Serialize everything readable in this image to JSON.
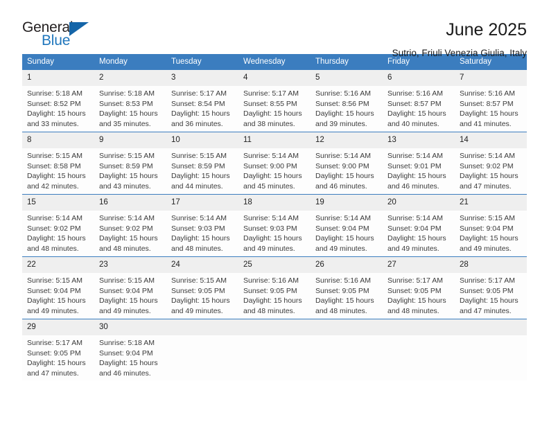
{
  "brand": {
    "name_part1": "General",
    "name_part2": "Blue",
    "logo_icon": "triangle-logo-icon"
  },
  "header": {
    "title": "June 2025",
    "subtitle": "Sutrio, Friuli Venezia Giulia, Italy"
  },
  "calendar": {
    "weekday_headers": [
      "Sunday",
      "Monday",
      "Tuesday",
      "Wednesday",
      "Thursday",
      "Friday",
      "Saturday"
    ],
    "accent_color": "#3b7dbf",
    "daynum_band_color": "#efefef",
    "weeks": [
      [
        {
          "day": "1",
          "sunrise": "Sunrise: 5:18 AM",
          "sunset": "Sunset: 8:52 PM",
          "daylight": "Daylight: 15 hours and 33 minutes."
        },
        {
          "day": "2",
          "sunrise": "Sunrise: 5:18 AM",
          "sunset": "Sunset: 8:53 PM",
          "daylight": "Daylight: 15 hours and 35 minutes."
        },
        {
          "day": "3",
          "sunrise": "Sunrise: 5:17 AM",
          "sunset": "Sunset: 8:54 PM",
          "daylight": "Daylight: 15 hours and 36 minutes."
        },
        {
          "day": "4",
          "sunrise": "Sunrise: 5:17 AM",
          "sunset": "Sunset: 8:55 PM",
          "daylight": "Daylight: 15 hours and 38 minutes."
        },
        {
          "day": "5",
          "sunrise": "Sunrise: 5:16 AM",
          "sunset": "Sunset: 8:56 PM",
          "daylight": "Daylight: 15 hours and 39 minutes."
        },
        {
          "day": "6",
          "sunrise": "Sunrise: 5:16 AM",
          "sunset": "Sunset: 8:57 PM",
          "daylight": "Daylight: 15 hours and 40 minutes."
        },
        {
          "day": "7",
          "sunrise": "Sunrise: 5:16 AM",
          "sunset": "Sunset: 8:57 PM",
          "daylight": "Daylight: 15 hours and 41 minutes."
        }
      ],
      [
        {
          "day": "8",
          "sunrise": "Sunrise: 5:15 AM",
          "sunset": "Sunset: 8:58 PM",
          "daylight": "Daylight: 15 hours and 42 minutes."
        },
        {
          "day": "9",
          "sunrise": "Sunrise: 5:15 AM",
          "sunset": "Sunset: 8:59 PM",
          "daylight": "Daylight: 15 hours and 43 minutes."
        },
        {
          "day": "10",
          "sunrise": "Sunrise: 5:15 AM",
          "sunset": "Sunset: 8:59 PM",
          "daylight": "Daylight: 15 hours and 44 minutes."
        },
        {
          "day": "11",
          "sunrise": "Sunrise: 5:14 AM",
          "sunset": "Sunset: 9:00 PM",
          "daylight": "Daylight: 15 hours and 45 minutes."
        },
        {
          "day": "12",
          "sunrise": "Sunrise: 5:14 AM",
          "sunset": "Sunset: 9:00 PM",
          "daylight": "Daylight: 15 hours and 46 minutes."
        },
        {
          "day": "13",
          "sunrise": "Sunrise: 5:14 AM",
          "sunset": "Sunset: 9:01 PM",
          "daylight": "Daylight: 15 hours and 46 minutes."
        },
        {
          "day": "14",
          "sunrise": "Sunrise: 5:14 AM",
          "sunset": "Sunset: 9:02 PM",
          "daylight": "Daylight: 15 hours and 47 minutes."
        }
      ],
      [
        {
          "day": "15",
          "sunrise": "Sunrise: 5:14 AM",
          "sunset": "Sunset: 9:02 PM",
          "daylight": "Daylight: 15 hours and 48 minutes."
        },
        {
          "day": "16",
          "sunrise": "Sunrise: 5:14 AM",
          "sunset": "Sunset: 9:02 PM",
          "daylight": "Daylight: 15 hours and 48 minutes."
        },
        {
          "day": "17",
          "sunrise": "Sunrise: 5:14 AM",
          "sunset": "Sunset: 9:03 PM",
          "daylight": "Daylight: 15 hours and 48 minutes."
        },
        {
          "day": "18",
          "sunrise": "Sunrise: 5:14 AM",
          "sunset": "Sunset: 9:03 PM",
          "daylight": "Daylight: 15 hours and 49 minutes."
        },
        {
          "day": "19",
          "sunrise": "Sunrise: 5:14 AM",
          "sunset": "Sunset: 9:04 PM",
          "daylight": "Daylight: 15 hours and 49 minutes."
        },
        {
          "day": "20",
          "sunrise": "Sunrise: 5:14 AM",
          "sunset": "Sunset: 9:04 PM",
          "daylight": "Daylight: 15 hours and 49 minutes."
        },
        {
          "day": "21",
          "sunrise": "Sunrise: 5:15 AM",
          "sunset": "Sunset: 9:04 PM",
          "daylight": "Daylight: 15 hours and 49 minutes."
        }
      ],
      [
        {
          "day": "22",
          "sunrise": "Sunrise: 5:15 AM",
          "sunset": "Sunset: 9:04 PM",
          "daylight": "Daylight: 15 hours and 49 minutes."
        },
        {
          "day": "23",
          "sunrise": "Sunrise: 5:15 AM",
          "sunset": "Sunset: 9:04 PM",
          "daylight": "Daylight: 15 hours and 49 minutes."
        },
        {
          "day": "24",
          "sunrise": "Sunrise: 5:15 AM",
          "sunset": "Sunset: 9:05 PM",
          "daylight": "Daylight: 15 hours and 49 minutes."
        },
        {
          "day": "25",
          "sunrise": "Sunrise: 5:16 AM",
          "sunset": "Sunset: 9:05 PM",
          "daylight": "Daylight: 15 hours and 48 minutes."
        },
        {
          "day": "26",
          "sunrise": "Sunrise: 5:16 AM",
          "sunset": "Sunset: 9:05 PM",
          "daylight": "Daylight: 15 hours and 48 minutes."
        },
        {
          "day": "27",
          "sunrise": "Sunrise: 5:17 AM",
          "sunset": "Sunset: 9:05 PM",
          "daylight": "Daylight: 15 hours and 48 minutes."
        },
        {
          "day": "28",
          "sunrise": "Sunrise: 5:17 AM",
          "sunset": "Sunset: 9:05 PM",
          "daylight": "Daylight: 15 hours and 47 minutes."
        }
      ],
      [
        {
          "day": "29",
          "sunrise": "Sunrise: 5:17 AM",
          "sunset": "Sunset: 9:05 PM",
          "daylight": "Daylight: 15 hours and 47 minutes."
        },
        {
          "day": "30",
          "sunrise": "Sunrise: 5:18 AM",
          "sunset": "Sunset: 9:04 PM",
          "daylight": "Daylight: 15 hours and 46 minutes."
        },
        {
          "day": "",
          "sunrise": "",
          "sunset": "",
          "daylight": ""
        },
        {
          "day": "",
          "sunrise": "",
          "sunset": "",
          "daylight": ""
        },
        {
          "day": "",
          "sunrise": "",
          "sunset": "",
          "daylight": ""
        },
        {
          "day": "",
          "sunrise": "",
          "sunset": "",
          "daylight": ""
        },
        {
          "day": "",
          "sunrise": "",
          "sunset": "",
          "daylight": ""
        }
      ]
    ]
  }
}
